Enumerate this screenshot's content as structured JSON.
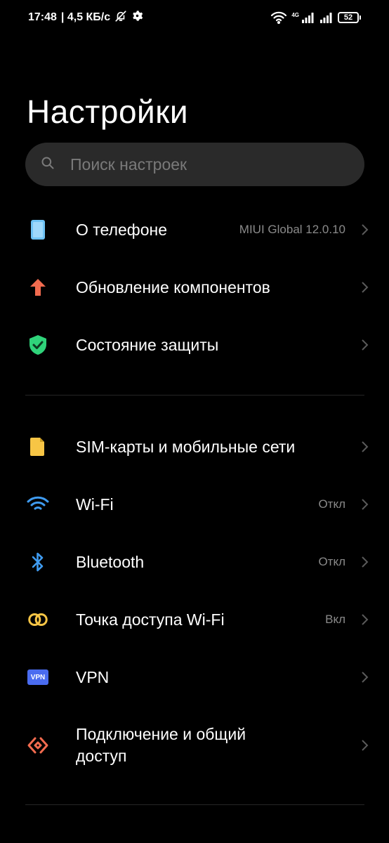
{
  "status_bar": {
    "time": "17:48",
    "speed": "| 4,5 КБ/с",
    "network_type": "4G",
    "battery": "52"
  },
  "header": {
    "title": "Настройки"
  },
  "search": {
    "placeholder": "Поиск настроек"
  },
  "items": [
    {
      "label": "О телефоне",
      "value": "MIUI Global 12.0.10",
      "icon": "phone-icon"
    },
    {
      "label": "Обновление компонентов",
      "value": "",
      "icon": "arrow-up-icon"
    },
    {
      "label": "Состояние защиты",
      "value": "",
      "icon": "shield-check-icon"
    },
    {
      "label": "SIM-карты и мобильные сети",
      "value": "",
      "icon": "sim-card-icon"
    },
    {
      "label": "Wi-Fi",
      "value": "Откл",
      "icon": "wifi-icon"
    },
    {
      "label": "Bluetooth",
      "value": "Откл",
      "icon": "bluetooth-icon"
    },
    {
      "label": "Точка доступа Wi-Fi",
      "value": "Вкл",
      "icon": "hotspot-icon"
    },
    {
      "label": "VPN",
      "value": "",
      "icon": "vpn-icon",
      "icon_text": "VPN"
    },
    {
      "label_line1": "Подключение и общий",
      "label_line2": "доступ",
      "value": "",
      "icon": "connection-sharing-icon"
    }
  ],
  "colors": {
    "background": "#000000",
    "search_bg": "#2a2a2a",
    "phone": "#6fc3f5",
    "update": "#f26b4f",
    "shield": "#2fd37a",
    "sim": "#f7c545",
    "wifi": "#3f9bf0",
    "bluetooth": "#3f9bf0",
    "hotspot": "#f7c545",
    "vpn": "#4a6cf0",
    "sharing": "#f26b4f"
  }
}
